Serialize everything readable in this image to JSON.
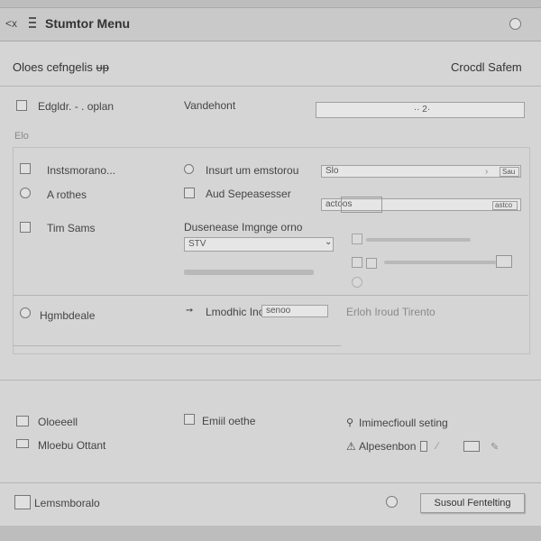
{
  "titlebar": {
    "title": "Stumtor Menu",
    "left_glyph": "<x",
    "menu_icon": "hamburger-icon",
    "help_icon": "help-icon"
  },
  "header": {
    "left_label": "Oloes cefngelis ᵾᵽ",
    "right_label": "Crocdl Safem"
  },
  "row1": {
    "label": "Edgldr. - . oplan",
    "center_label": "Vandehont",
    "field_value": "·· 2·"
  },
  "section": {
    "label": "Elo"
  },
  "left_items": [
    {
      "label": "Instsmorano..."
    },
    {
      "label": "A rothes"
    },
    {
      "label": "Tim Sams"
    }
  ],
  "middle_items": [
    {
      "label": "Insurt um emstorou"
    },
    {
      "label": "Aud Sepeasesser"
    },
    {
      "label": "Dusenease Imgnge orno"
    },
    {
      "label": "STV"
    }
  ],
  "right_fields": [
    {
      "value": "Slo",
      "badge": "Sau"
    },
    {
      "value": "actoos",
      "badge": "astco"
    }
  ],
  "lower": {
    "left_label": "Hgmbdeale",
    "middle_label": "Lmodhic Inc",
    "middle_field": "senoo",
    "right_label": "Erloh Iroud Tirento"
  },
  "bottom": {
    "items_left": [
      {
        "label": "Oloeeell"
      },
      {
        "label": "Mloebu Ottant"
      }
    ],
    "items_mid": [
      {
        "label": "Emiil oethe"
      }
    ],
    "items_right": [
      {
        "label": "Imimecfioull seting"
      },
      {
        "label": "Alpesenbon"
      }
    ]
  },
  "footer": {
    "label": "Lemsmboralo",
    "button_label": "Susoul Fentelting"
  }
}
